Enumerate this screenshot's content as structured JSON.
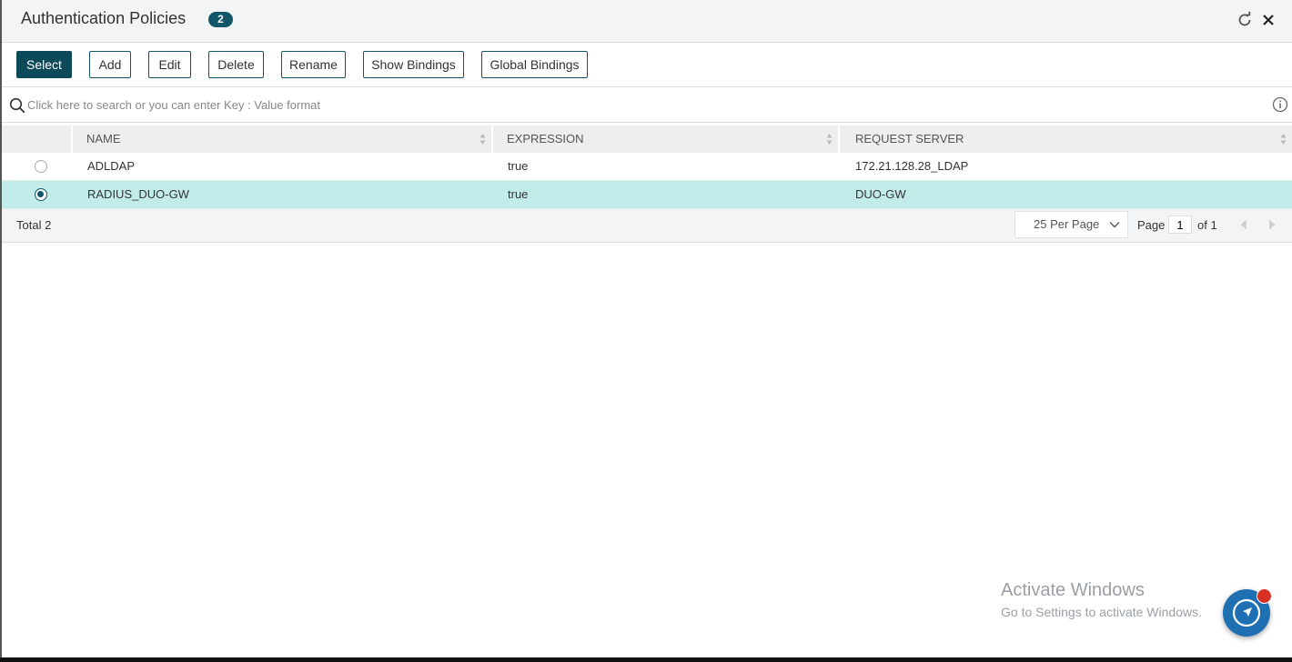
{
  "header": {
    "title": "Authentication Policies",
    "count_badge": "2"
  },
  "toolbar": {
    "select": "Select",
    "add": "Add",
    "edit": "Edit",
    "delete": "Delete",
    "rename": "Rename",
    "show_bindings": "Show Bindings",
    "global_bindings": "Global Bindings"
  },
  "search": {
    "placeholder": "Click here to search or you can enter Key : Value format"
  },
  "table": {
    "columns": [
      "NAME",
      "EXPRESSION",
      "REQUEST SERVER"
    ],
    "rows": [
      {
        "name": "ADLDAP",
        "expression": "true",
        "request_server": "172.21.128.28_LDAP",
        "selected": false
      },
      {
        "name": "RADIUS_DUO-GW",
        "expression": "true",
        "request_server": "DUO-GW",
        "selected": true
      }
    ]
  },
  "footer": {
    "total_label": "Total",
    "total_value": "2",
    "per_page": "25 Per Page",
    "page_label": "Page",
    "page_value": "1",
    "of_label": "of 1"
  },
  "watermark": {
    "line1": "Activate Windows",
    "line2": "Go to Settings to activate Windows."
  },
  "colors": {
    "accent": "#115568",
    "selected_row": "#c2ece9",
    "fab": "#1f6fb3",
    "notification_dot": "#d93025"
  }
}
